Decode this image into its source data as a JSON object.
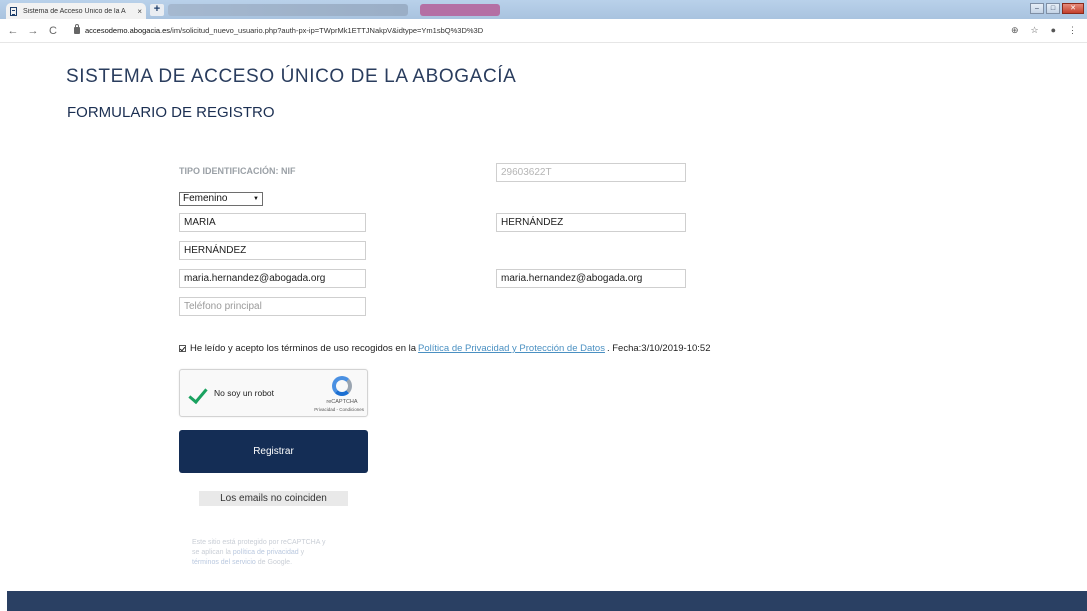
{
  "browser": {
    "tab_title": "Sistema de Acceso Único de la A",
    "tab_close": "×",
    "new_tab": "+",
    "url_host": "accesodemo.abogacia.es",
    "url_path": "/im/solicitud_nuevo_usuario.php?auth-px-ip=TWprMk1ETTJNakpV&idtype=Ym1sbQ%3D%3D",
    "nav_back": "←",
    "nav_forward": "→",
    "nav_reload": "C",
    "zoom_icon": "⊕",
    "star_icon": "☆",
    "account_icon": "●",
    "menu_icon": "⋮",
    "win_min": "–",
    "win_max": "□",
    "win_close": "✕"
  },
  "page": {
    "site_title": "SISTEMA DE ACCESO ÚNICO DE LA ABOGACÍA",
    "form_title": "FORMULARIO DE REGISTRO"
  },
  "form": {
    "id_label": "TIPO IDENTIFICACIÓN: NIF",
    "nif_value": "29603622T",
    "gender_selected": "Femenino",
    "first_name": "MARIA",
    "surname1": "HERNÁNDEZ",
    "surname2": "HERNÁNDEZ",
    "email": "maria.hernandez@abogada.org",
    "email_confirm": "maria.hernandez@abogada.org",
    "phone_placeholder": "Teléfono principal",
    "terms_checked": true,
    "terms_prefix": "He leído y acepto los términos de uso recogidos en la",
    "terms_link": "Política de Privacidad y Protección de Datos",
    "terms_suffix": ". Fecha:3/10/2019-10:52",
    "submit_label": "Registrar",
    "error_message": "Los emails no coinciden"
  },
  "captcha": {
    "label": "No soy un robot",
    "brand": "reCAPTCHA",
    "terms": "Privacidad - Condiciones"
  },
  "recaptcha_note": {
    "line1": "Este sitio está protegido por reCAPTCHA y",
    "line2_prefix": "se aplican la",
    "privacy_link": "política de privacidad",
    "line2_suffix": "y",
    "terms_link": "términos del servicio",
    "line3_suffix": "de Google."
  },
  "colors": {
    "primary": "#142d55",
    "title": "#2a3d5e",
    "link": "#4a90c2",
    "footer": "#2a4063"
  }
}
